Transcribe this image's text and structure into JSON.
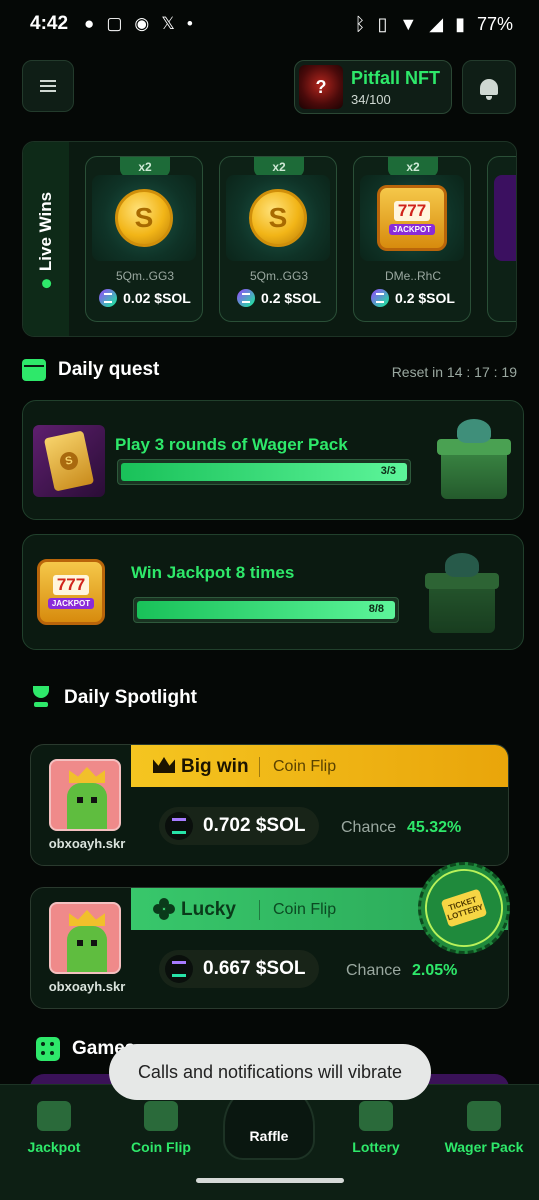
{
  "status_bar": {
    "time": "4:42",
    "battery": "77%"
  },
  "header": {
    "nft_title": "Pitfall NFT",
    "nft_count": "34/100",
    "nft_thumb_glyph": "?"
  },
  "live_wins": {
    "label": "Live Wins",
    "items": [
      {
        "multiplier": "x2",
        "user": "5Qm..GG3",
        "amount": "0.02 $SOL",
        "art": "coin"
      },
      {
        "multiplier": "x2",
        "user": "5Qm..GG3",
        "amount": "0.2 $SOL",
        "art": "coin"
      },
      {
        "multiplier": "x2",
        "user": "DMe..RhC",
        "amount": "0.2 $SOL",
        "art": "slot"
      }
    ]
  },
  "daily_quest": {
    "title": "Daily quest",
    "reset": "Reset in 14 : 17 : 19",
    "quests": [
      {
        "title": "Play 3 rounds of Wager Pack",
        "progress_text": "3/3",
        "progress": 1.0
      },
      {
        "title": "Win Jackpot 8 times",
        "progress_text": "8/8",
        "progress": 1.0
      }
    ]
  },
  "daily_spotlight": {
    "title": "Daily Spotlight",
    "cards": [
      {
        "badge": "Big win",
        "game": "Coin Flip",
        "user": "obxoayh.skr",
        "amount": "0.702 $SOL",
        "chance_label": "Chance",
        "chance": "45.32%"
      },
      {
        "badge": "Lucky",
        "game": "Coin Flip",
        "user": "obxoayh.skr",
        "amount": "0.667 $SOL",
        "chance_label": "Chance",
        "chance": "2.05%"
      }
    ],
    "lottery_badge": "TICKET LOTTERY"
  },
  "games": {
    "title": "Games"
  },
  "toast": "Calls and notifications will vibrate",
  "bottom_nav": {
    "items": [
      "Jackpot",
      "Coin Flip",
      "Raffle",
      "Lottery",
      "Wager Pack"
    ]
  },
  "slot_art": {
    "sevens": "777",
    "jackpot": "JACKPOT"
  },
  "colors": {
    "accent": "#2ee86a",
    "gold": "#f5c520",
    "background": "#050806"
  }
}
